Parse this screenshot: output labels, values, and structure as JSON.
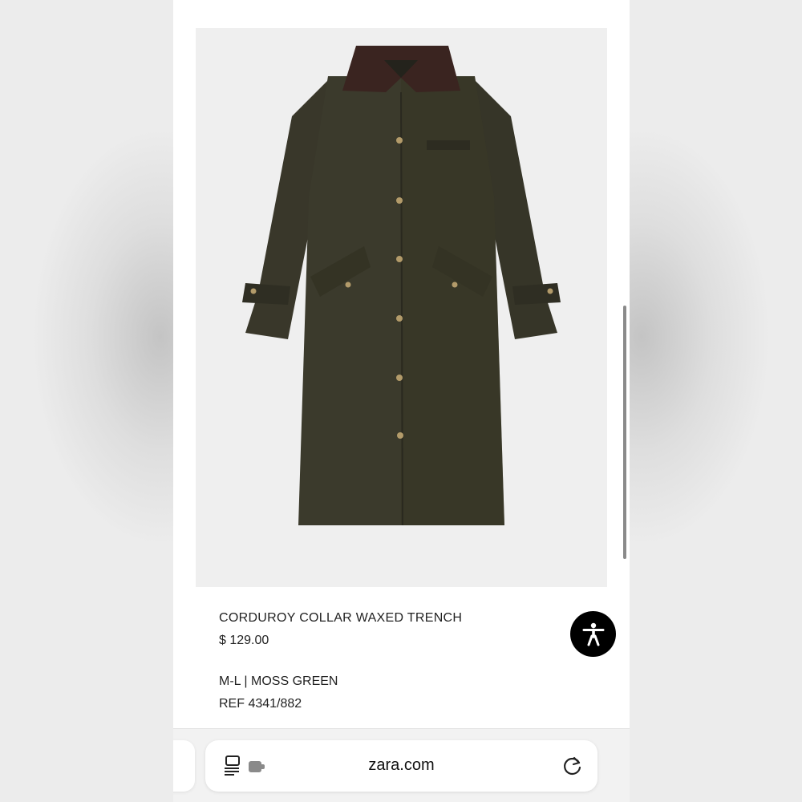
{
  "product": {
    "name": "CORDUROY COLLAR WAXED TRENCH",
    "price": "$ 129.00",
    "variant": "M-L | MOSS GREEN",
    "ref": "REF 4341/882",
    "image_icon": "product-photo-coat",
    "coat_color": "#3b3a2c",
    "collar_color": "#3a2420"
  },
  "accessibility_button": {
    "icon": "accessibility-person-icon"
  },
  "browser": {
    "address": "zara.com",
    "reader_icon": "reader-mode-extension-icon",
    "reload_icon": "reload-icon"
  }
}
